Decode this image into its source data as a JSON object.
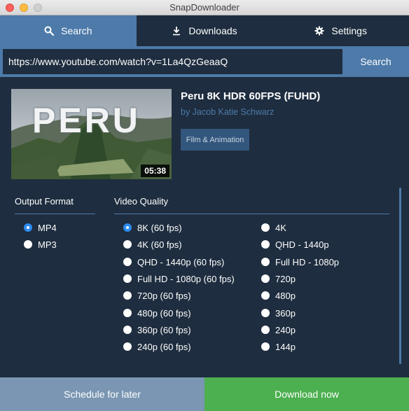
{
  "window": {
    "title": "SnapDownloader"
  },
  "tabs": [
    {
      "label": "Search",
      "icon": "search-icon",
      "active": true
    },
    {
      "label": "Downloads",
      "icon": "download-arrow-icon",
      "active": false
    },
    {
      "label": "Settings",
      "icon": "gear-icon",
      "active": false
    }
  ],
  "search": {
    "url_value": "https://www.youtube.com/watch?v=1La4QzGeaaQ",
    "button_label": "Search"
  },
  "video": {
    "title": "Peru 8K HDR 60FPS (FUHD)",
    "author": "by Jacob Katie Schwarz",
    "category": "Film & Animation",
    "duration": "05:38",
    "thumbnail_text": "PERU"
  },
  "output_format": {
    "heading": "Output Format",
    "options": [
      {
        "label": "MP4",
        "checked": true
      },
      {
        "label": "MP3",
        "checked": false
      }
    ]
  },
  "video_quality": {
    "heading": "Video Quality",
    "column1": [
      {
        "label": "8K (60 fps)",
        "checked": true
      },
      {
        "label": "4K (60 fps)",
        "checked": false
      },
      {
        "label": "QHD - 1440p (60 fps)",
        "checked": false
      },
      {
        "label": "Full HD - 1080p (60 fps)",
        "checked": false
      },
      {
        "label": "720p (60 fps)",
        "checked": false
      },
      {
        "label": "480p (60 fps)",
        "checked": false
      },
      {
        "label": "360p (60 fps)",
        "checked": false
      },
      {
        "label": "240p (60 fps)",
        "checked": false
      }
    ],
    "column2": [
      {
        "label": "4K",
        "checked": false
      },
      {
        "label": "QHD - 1440p",
        "checked": false
      },
      {
        "label": "Full HD - 1080p",
        "checked": false
      },
      {
        "label": "720p",
        "checked": false
      },
      {
        "label": "480p",
        "checked": false
      },
      {
        "label": "360p",
        "checked": false
      },
      {
        "label": "240p",
        "checked": false
      },
      {
        "label": "144p",
        "checked": false
      }
    ]
  },
  "actions": {
    "schedule_label": "Schedule for later",
    "download_label": "Download now"
  },
  "colors": {
    "background": "#1e2d3f",
    "accent_blue": "#4d7aa9",
    "radio_checked": "#2d8cf0",
    "download_green": "#4caf50",
    "schedule_gray_blue": "#7a96b2"
  }
}
